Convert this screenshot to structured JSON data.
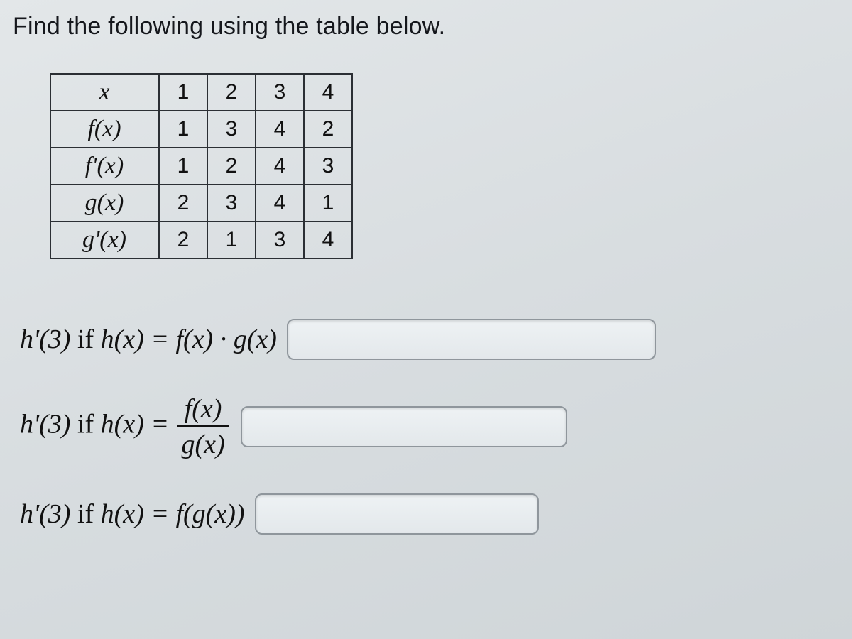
{
  "prompt": "Find the following using the table below.",
  "table": {
    "rows": [
      {
        "label": "x",
        "values": [
          "1",
          "2",
          "3",
          "4"
        ]
      },
      {
        "label": "f(x)",
        "values": [
          "1",
          "3",
          "4",
          "2"
        ]
      },
      {
        "label": "f'(x)",
        "values": [
          "1",
          "2",
          "4",
          "3"
        ]
      },
      {
        "label": "g(x)",
        "values": [
          "2",
          "3",
          "4",
          "1"
        ]
      },
      {
        "label": "g'(x)",
        "values": [
          "2",
          "1",
          "3",
          "4"
        ]
      }
    ]
  },
  "questions": {
    "q1": {
      "lhs": "h'(3)",
      "mid": " if ",
      "eq": "h(x) = f(x) · g(x)",
      "aria": "answer for product rule"
    },
    "q2": {
      "lhs": "h'(3)",
      "mid": " if ",
      "eq_prefix": "h(x) = ",
      "frac_num": "f(x)",
      "frac_den": "g(x)",
      "aria": "answer for quotient rule"
    },
    "q3": {
      "lhs": "h'(3)",
      "mid": " if ",
      "eq": "h(x) = f(g(x))",
      "aria": "answer for chain rule"
    }
  }
}
